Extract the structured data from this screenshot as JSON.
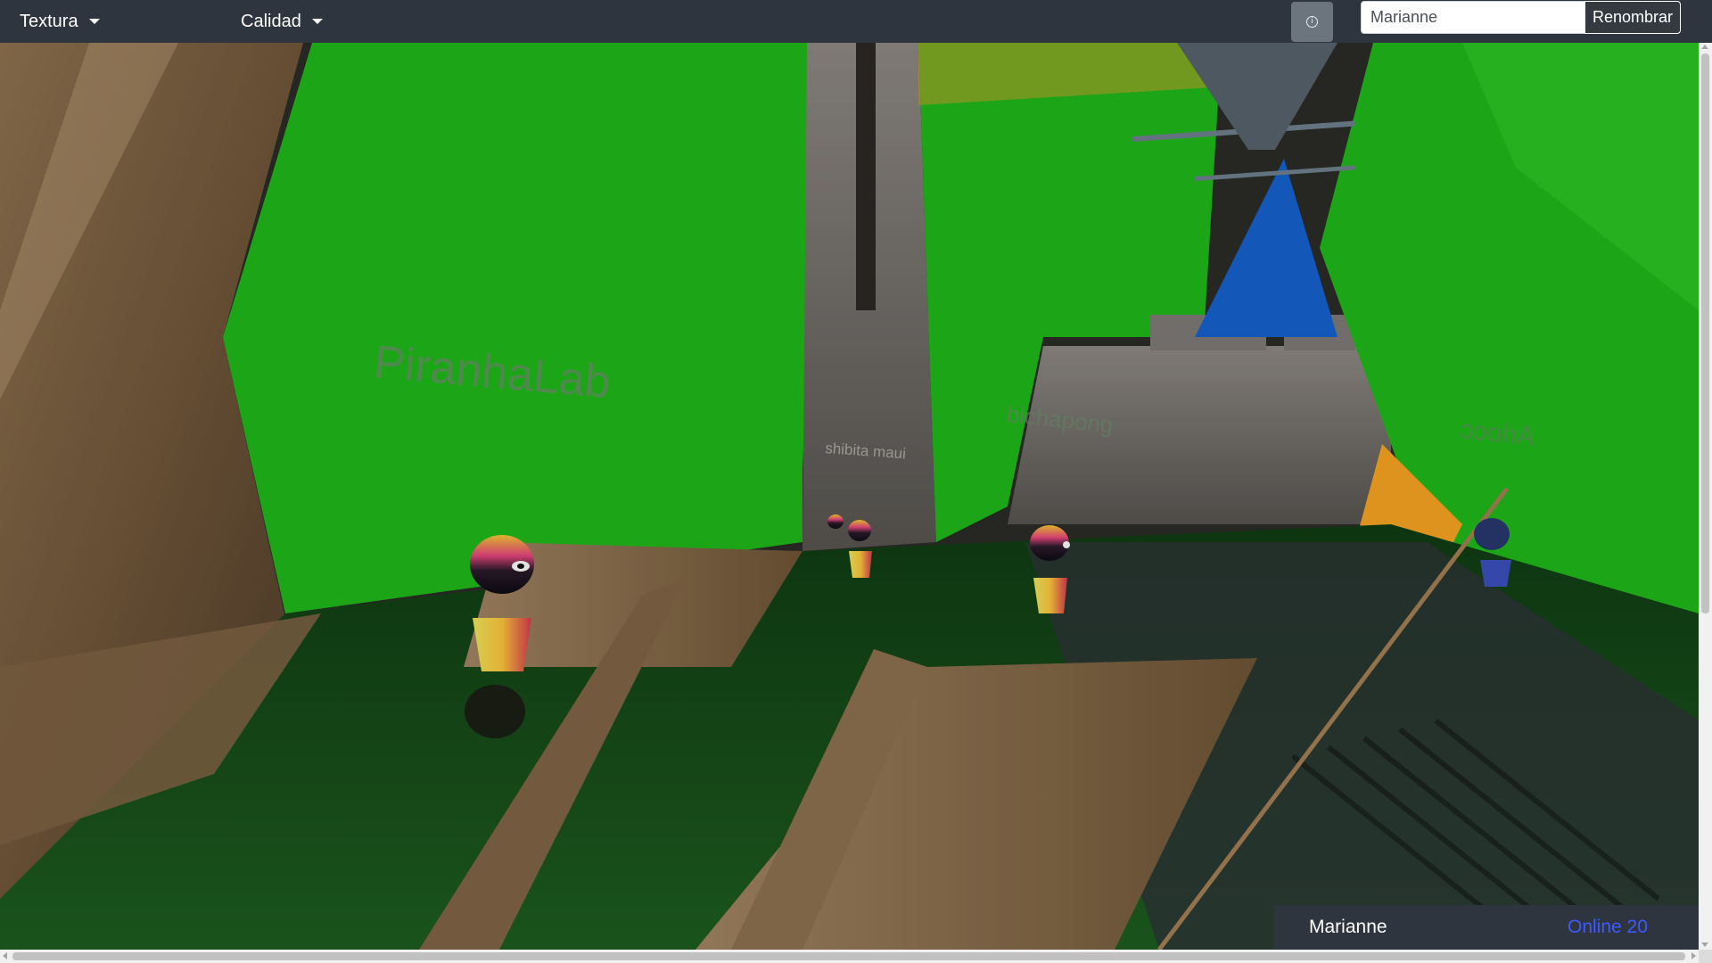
{
  "navbar": {
    "texture_menu": "Textura",
    "quality_menu": "Calidad",
    "info_icon": "info-icon",
    "name_value": "Marianne",
    "rename_label": "Renombrar"
  },
  "scene": {
    "wall_texts": [
      "PiranhaLab",
      "bichapong",
      "shibita maui",
      "Arlocc"
    ]
  },
  "player_panel": {
    "name": "Marianne",
    "online_label": "Online 20"
  },
  "colors": {
    "navbar_bg": "#2f353f",
    "green_screen": "#1fb51a",
    "online_accent": "#3d5afe"
  }
}
